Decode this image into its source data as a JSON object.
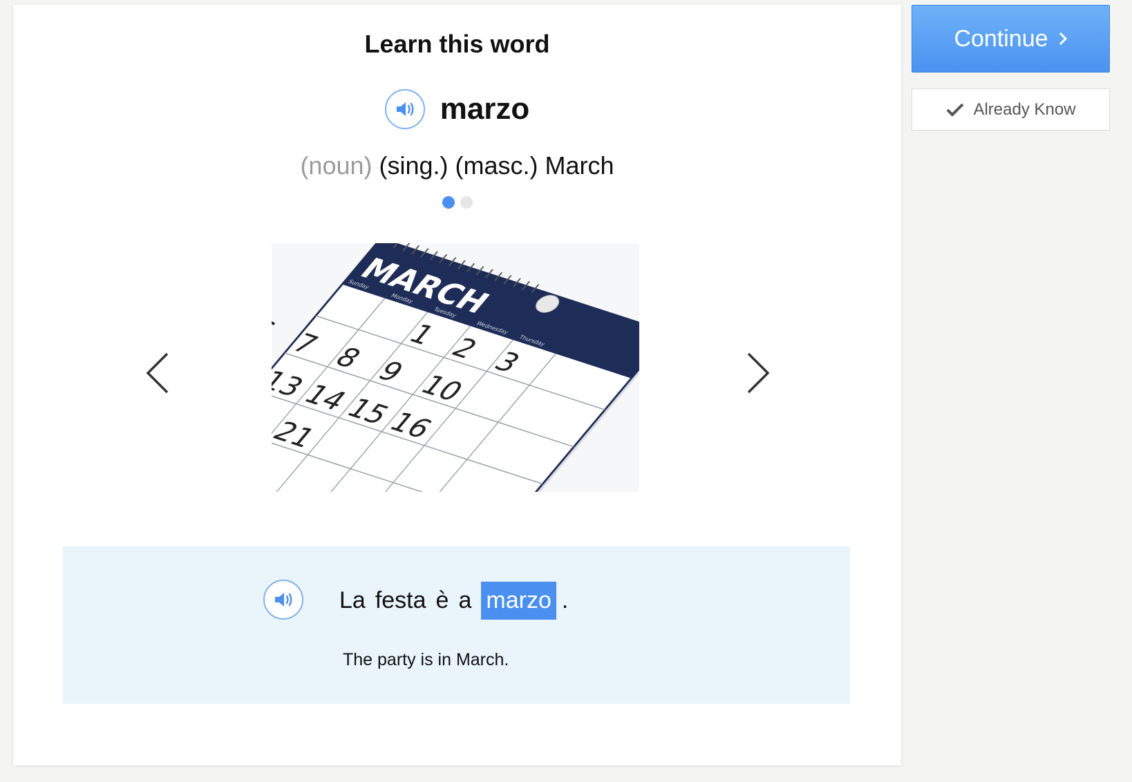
{
  "lesson": {
    "heading": "Learn this word",
    "word": "marzo",
    "pos": "(noun)",
    "definition": "(sing.) (masc.) March",
    "slides": {
      "count": 2,
      "active": 1
    }
  },
  "photo": {
    "month": "MARCH",
    "weekdays": [
      "Sunday",
      "Monday",
      "Tuesday",
      "Wednesday",
      "Thursday"
    ],
    "visible_dates": [
      "1",
      "2",
      "3",
      "6",
      "7",
      "8",
      "9",
      "10",
      "13",
      "14",
      "15",
      "16",
      "20",
      "21"
    ]
  },
  "example": {
    "words": [
      "La",
      "festa",
      "è",
      "a"
    ],
    "highlight": "marzo",
    "end": ".",
    "translation": "The party is in March."
  },
  "actions": {
    "continue_label": "Continue",
    "already_know_label": "Already Know"
  },
  "colors": {
    "accent": "#4b8ff0",
    "example_bg": "#eaf4fb",
    "calendar_header": "#1e2d57"
  }
}
